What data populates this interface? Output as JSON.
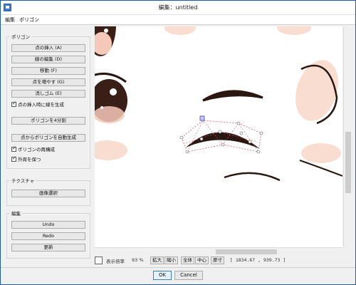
{
  "window": {
    "title": "編集：untitled"
  },
  "menu": {
    "items": [
      "編集",
      "ポリゴン"
    ]
  },
  "polygon_group": {
    "label": "ポリゴン",
    "buttons": [
      "点の挿入 (A)",
      "線の編集 (D)",
      "移動 (F)",
      "点を増やす (G)",
      "消しゴム (E)"
    ],
    "check_insert_line": "点の挿入時に線を生成",
    "split_button": "ポリゴンを4分割",
    "auto_button": "点からポリゴンを自動生成",
    "check_rebuild": "ポリゴンの再構成",
    "check_keep_outline": "外周を保つ"
  },
  "texture_group": {
    "label": "テクスチャ",
    "select_image_button": "画像選択"
  },
  "edit_group": {
    "label": "編集",
    "undo": "Undo",
    "redo": "Redo",
    "refresh": "更新"
  },
  "status": {
    "zoom_label": "表示倍率",
    "zoom_value": "93 %",
    "zoom_in": "拡大",
    "zoom_out": "縮小",
    "fit_all": "全体",
    "center": "中心",
    "actual_size": "原寸",
    "coords": "[ 1834.67 , 939.73 ]"
  },
  "dialog": {
    "ok": "OK",
    "cancel": "Cancel"
  },
  "colors": {
    "skin": "#f8ddd0",
    "eye_dark": "#3a1f17",
    "mesh": "#e0607a",
    "handle": "#4040c0"
  }
}
